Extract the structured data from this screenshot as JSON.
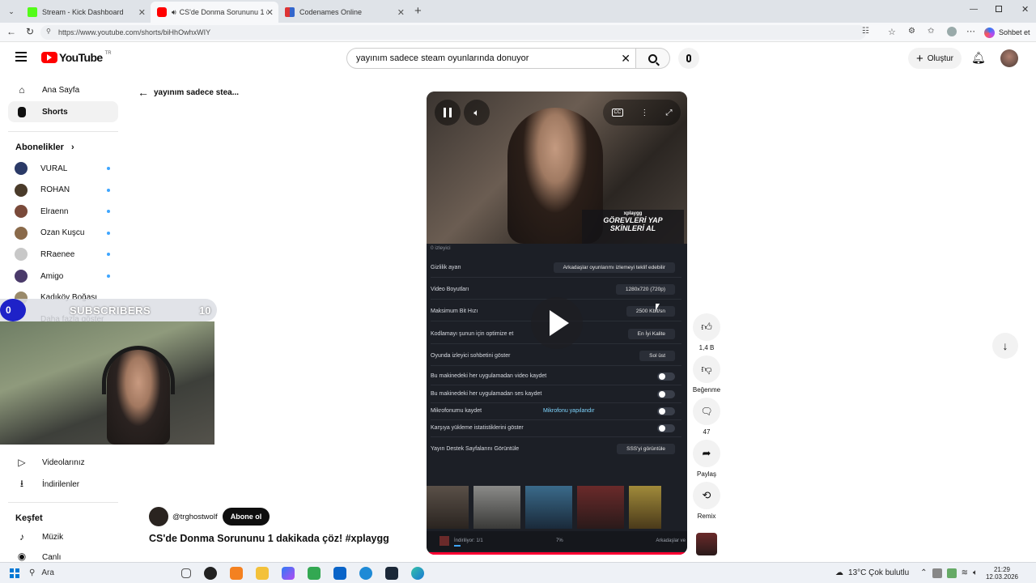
{
  "browser": {
    "tabs": [
      {
        "title": "Stream - Kick Dashboard",
        "active": false
      },
      {
        "title": "CS'de Donma Sorununu 1 dak",
        "active": true
      },
      {
        "title": "Codenames Online",
        "active": false
      }
    ],
    "new_tab": "+",
    "url": "https://www.youtube.com/shorts/biHhOwhxWIY",
    "copilot_label": "Sohbet et"
  },
  "youtube": {
    "logo_text": "YouTube",
    "region": "TR",
    "search_value": "yayınım sadece steam oyunlarında donuyor",
    "create_label": "Oluştur",
    "back_label": "yayınım sadece stea...",
    "sidebar": {
      "home": "Ana Sayfa",
      "shorts": "Shorts",
      "subscriptions_title": "Abonelikler",
      "subscriptions": [
        {
          "name": "VURAL",
          "color": "#2b3a67"
        },
        {
          "name": "ROHAN",
          "color": "#4a3b2a"
        },
        {
          "name": "Elraenn",
          "color": "#7a4a3a"
        },
        {
          "name": "Ozan Kuşcu",
          "color": "#8a6a4a"
        },
        {
          "name": "RRaenee",
          "color": "#c8c8c8"
        },
        {
          "name": "Amigo",
          "color": "#4a3a6a"
        },
        {
          "name": "Kadıköy Boğası",
          "color": "#9a8a6a"
        }
      ],
      "show_more": "Daha fazla göster",
      "your_videos": "Videolarınız",
      "downloads": "İndirilenler",
      "explore_title": "Keşfet",
      "music": "Müzik",
      "live": "Canlı"
    },
    "short": {
      "channel": "@trghostwolf",
      "subscribe": "Abone ol",
      "title": "CS'de Donma Sorununu 1 dakikada çöz!  #xplaygg"
    },
    "player": {
      "banner_brand": "xplaygg",
      "banner_line1": "GÖREVLERİ YAP",
      "banner_line2": "SKİNLERİ AL",
      "viewers": "0 izleyici",
      "settings": [
        {
          "label": "Gizlilik ayarı",
          "value": "Arkadaşlar oyunlarımı izlemeyi teklif edebilir"
        },
        {
          "label": "Video Boyutları",
          "value": "1280x720 (720p)"
        },
        {
          "label": "Maksimum Bit Hızı",
          "value": "2500 Kbit/sn"
        },
        {
          "label": "Kodlamayı şunun için optimize et",
          "value": "En İyi Kalite"
        },
        {
          "label": "Oyunda izleyici sohbetini göster",
          "value": "Sol üst"
        }
      ],
      "toggles": [
        {
          "label": "Bu makinedeki her uygulamadan video kaydet"
        },
        {
          "label": "Bu makinedeki her uygulamadan ses kaydet"
        },
        {
          "label": "Mikrofonumu kaydet",
          "extra": "Mikrofonu yapılandır"
        },
        {
          "label": "Karşıya yükleme istatistiklerini göster"
        }
      ],
      "support_label": "Yayın Destek Sayfalarını Görüntüle",
      "support_button": "SSS'yi görüntüle",
      "download_status": "İndiriliyor: 1/1",
      "download_percent": "7%",
      "friends_label": "Arkadaşlar ve"
    },
    "actions": {
      "like_count": "1,4 B",
      "dislike": "Beğenme",
      "comments": "47",
      "share": "Paylaş",
      "remix": "Remix"
    }
  },
  "overlay": {
    "sub_count_left": "0",
    "sub_title": "SUBSCRIBERS",
    "sub_goal": "10"
  },
  "taskbar": {
    "search": "Ara",
    "weather": "13°C  Çok bulutlu",
    "time": "21:29",
    "date": "12.03.2026"
  }
}
